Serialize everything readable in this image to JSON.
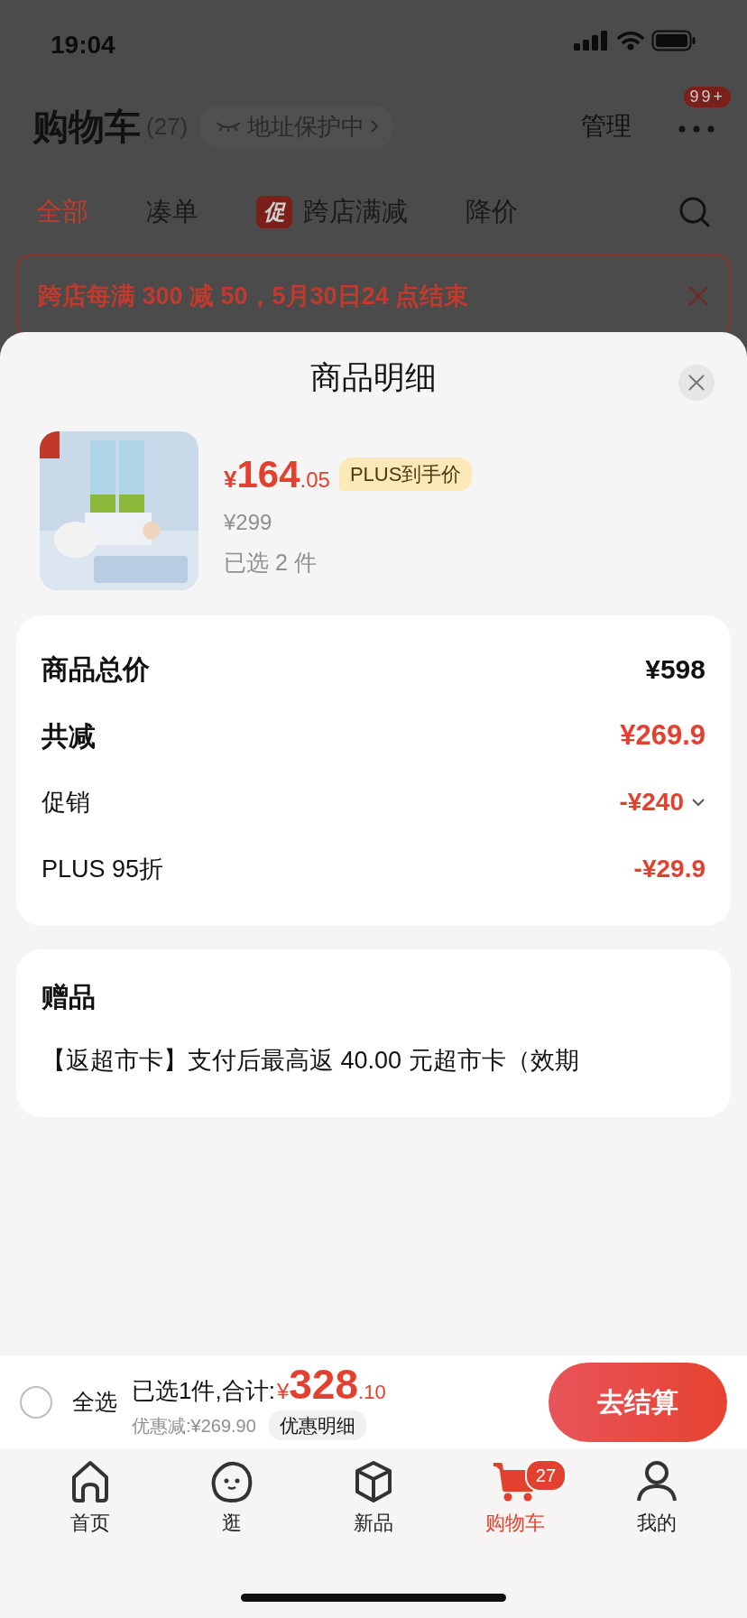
{
  "status_bar": {
    "time": "19:04"
  },
  "header": {
    "title": "购物车",
    "count": "(27)",
    "address_chip": "地址保护中",
    "manage": "管理",
    "more_badge": "99+"
  },
  "filter_tabs": [
    {
      "label": "全部",
      "selected": true
    },
    {
      "label": "凑单",
      "selected": false
    },
    {
      "label": "跨店满减",
      "selected": false,
      "tag": "促"
    },
    {
      "label": "降价",
      "selected": false
    }
  ],
  "promo_banner": {
    "text": "跨店每满 300 减 50，5月30日24 点结束"
  },
  "sheet": {
    "title": "商品明细",
    "product": {
      "kind": "picture",
      "currency": "¥",
      "price_int": "164",
      "price_dec": ".05",
      "price_tag": "PLUS到手价",
      "original_price": "¥299",
      "selected_count": "已选 2 件"
    },
    "summary": [
      {
        "kind": "total",
        "label": "商品总价",
        "value": "¥598",
        "expandable": false
      },
      {
        "kind": "reduction",
        "label": "共减",
        "value": "¥269.9",
        "expandable": false
      },
      {
        "kind": "line",
        "label": "促销",
        "value": "-¥240",
        "expandable": true
      },
      {
        "kind": "line",
        "label": "PLUS 95折",
        "value": "-¥29.9",
        "expandable": false
      }
    ],
    "gifts": {
      "title": "赠品",
      "text": "【返超市卡】支付后最高返 40.00 元超市卡（效期"
    }
  },
  "checkout_bar": {
    "select_all": {
      "label": "全选",
      "checked": false
    },
    "summary": "已选1件,合计:",
    "currency": "¥",
    "total_int": "328",
    "total_dec": ".10",
    "discount": "优惠减:¥269.90",
    "discount_detail_button": "优惠明细",
    "checkout_button": "去结算"
  },
  "bottom_nav": [
    {
      "label": "首页",
      "selected": false
    },
    {
      "label": "逛",
      "selected": false
    },
    {
      "label": "新品",
      "selected": false
    },
    {
      "label": "购物车",
      "selected": true,
      "badge": "27"
    },
    {
      "label": "我的",
      "selected": false
    }
  ]
}
